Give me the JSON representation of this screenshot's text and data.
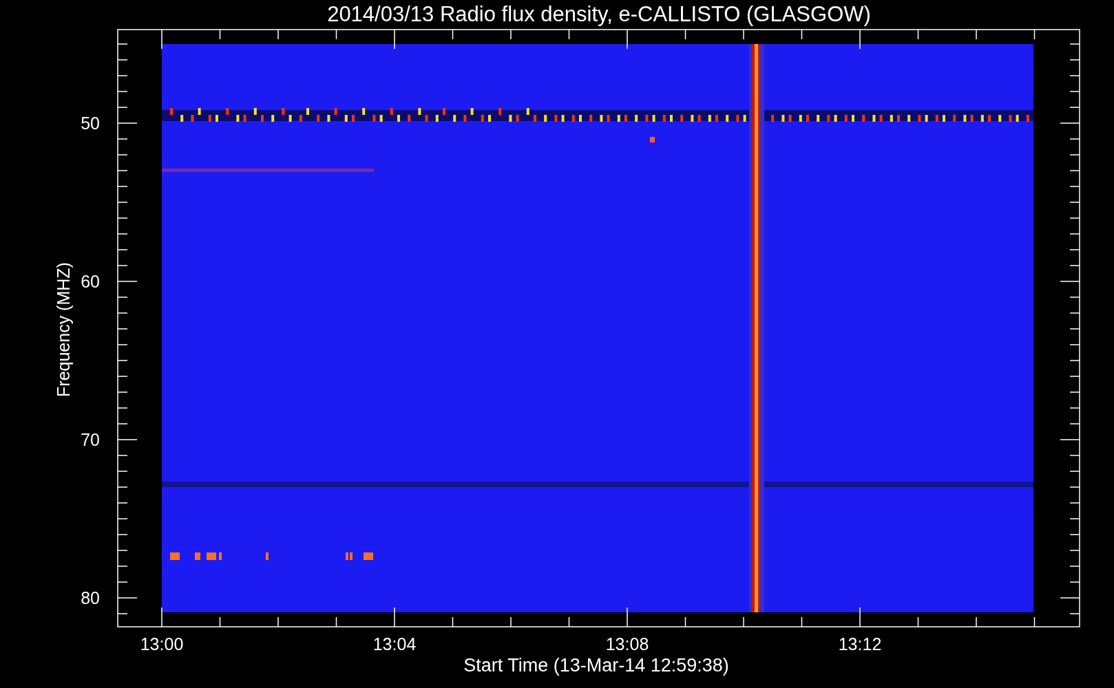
{
  "plot": {
    "title": "2014/03/13  Radio flux density, e-CALLISTO (GLASGOW)",
    "x_axis": {
      "label": "Start Time (13-Mar-14 12:59:38)",
      "ticks": [
        "13:00",
        "13:04",
        "13:08",
        "13:12"
      ]
    },
    "y_axis": {
      "label": "Frequency (MHZ)",
      "ticks": [
        "50",
        "60",
        "70",
        "80"
      ]
    }
  }
}
